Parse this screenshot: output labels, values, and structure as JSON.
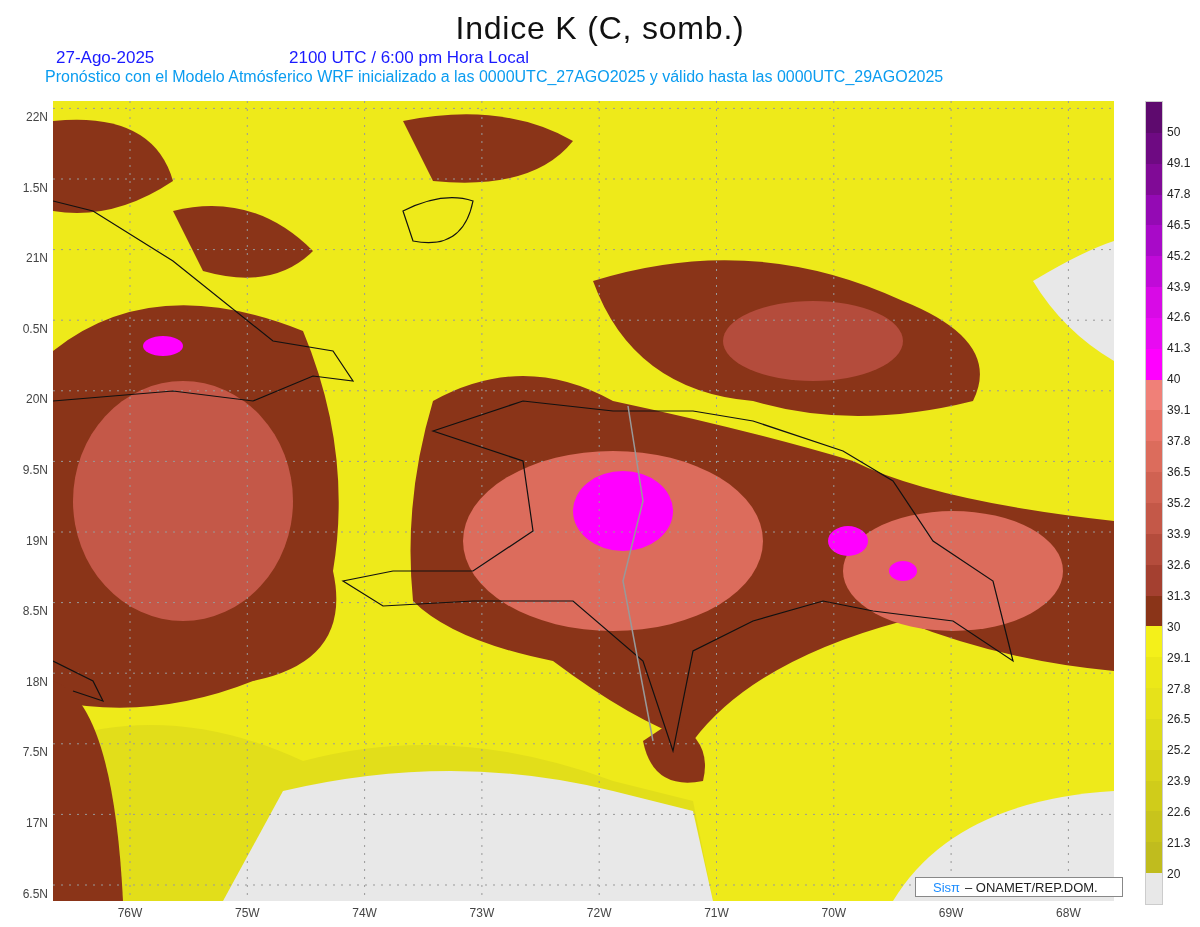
{
  "title": "Indice K (C, somb.)",
  "date": "27-Ago-2025",
  "time": "2100 UTC / 6:00 pm Hora Local",
  "subtitle": "Pronóstico con el Modelo Atmósferico WRF inicializado a las 0000UTC_27AGO2025 y válido hasta las  0000UTC_29AGO2025",
  "lat_labels": [
    "22N",
    "1.5N",
    "21N",
    "0.5N",
    "20N",
    "9.5N",
    "19N",
    "8.5N",
    "18N",
    "7.5N",
    "17N",
    "6.5N"
  ],
  "lon_labels": [
    "76W",
    "75W",
    "74W",
    "73W",
    "72W",
    "71W",
    "70W",
    "69W",
    "68W"
  ],
  "legend": [
    {
      "color": "#5e0a6e",
      "label": "50"
    },
    {
      "color": "#6e0a82",
      "label": "49.1"
    },
    {
      "color": "#800a96",
      "label": "47.8"
    },
    {
      "color": "#940ab4",
      "label": "46.5"
    },
    {
      "color": "#a80ac8",
      "label": "45.2"
    },
    {
      "color": "#c00ad8",
      "label": "43.9"
    },
    {
      "color": "#d80ae6",
      "label": "42.6"
    },
    {
      "color": "#e80af2",
      "label": "41.3"
    },
    {
      "color": "#ff00ff",
      "label": "40"
    },
    {
      "color": "#f08078",
      "label": "39.1"
    },
    {
      "color": "#e87468",
      "label": "37.8"
    },
    {
      "color": "#dc6c5c",
      "label": "36.5"
    },
    {
      "color": "#d06252",
      "label": "35.2"
    },
    {
      "color": "#c45848",
      "label": "33.9"
    },
    {
      "color": "#b44c3c",
      "label": "32.6"
    },
    {
      "color": "#a44030",
      "label": "31.3"
    },
    {
      "color": "#8a3418",
      "label": "30"
    },
    {
      "color": "#f4f01a",
      "label": "29.1"
    },
    {
      "color": "#ece818",
      "label": "27.8"
    },
    {
      "color": "#e6e21a",
      "label": "26.5"
    },
    {
      "color": "#dedc1a",
      "label": "25.2"
    },
    {
      "color": "#d8d41a",
      "label": "23.9"
    },
    {
      "color": "#d0cc1a",
      "label": "22.6"
    },
    {
      "color": "#c8c41c",
      "label": "21.3"
    },
    {
      "color": "#c0bc1e",
      "label": "20"
    },
    {
      "color": "#e8e8e8"
    }
  ],
  "credit": {
    "logo": "Sisπ",
    "text": "– ONAMET/REP.DOM."
  }
}
